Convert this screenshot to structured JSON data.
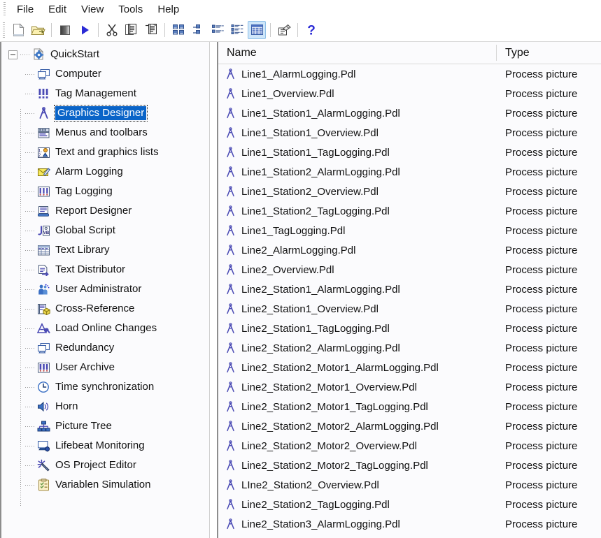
{
  "menubar": {
    "items": [
      {
        "label": "File",
        "name": "menu-file"
      },
      {
        "label": "Edit",
        "name": "menu-edit"
      },
      {
        "label": "View",
        "name": "menu-view"
      },
      {
        "label": "Tools",
        "name": "menu-tools"
      },
      {
        "label": "Help",
        "name": "menu-help"
      }
    ]
  },
  "toolbar": {
    "buttons": [
      {
        "icon": "new-document-icon",
        "active": false
      },
      {
        "icon": "open-folder-icon",
        "active": false
      },
      {
        "sep": true
      },
      {
        "icon": "stop-icon",
        "active": false
      },
      {
        "icon": "play-icon",
        "active": false
      },
      {
        "sep": true
      },
      {
        "icon": "cut-scissors-icon",
        "active": false
      },
      {
        "icon": "copy-icon",
        "active": false
      },
      {
        "icon": "paste-icon",
        "active": false
      },
      {
        "sep": true
      },
      {
        "icon": "large-icons-view-icon",
        "active": false
      },
      {
        "icon": "small-icons-view-icon",
        "active": false
      },
      {
        "icon": "list-view-icon",
        "active": false
      },
      {
        "icon": "tile-view-icon",
        "active": false
      },
      {
        "icon": "details-view-icon",
        "active": true
      },
      {
        "sep": true
      },
      {
        "icon": "properties-icon",
        "active": false
      },
      {
        "sep": true
      },
      {
        "icon": "help-question-icon",
        "active": false
      }
    ]
  },
  "colors": {
    "selection": "#0a64c8",
    "selection_text": "#ffffff",
    "toolbar_active": "#cfe6f9",
    "icon_blue": "#4a4ab4",
    "pane_background": "#fbfbfd"
  },
  "tree": {
    "root": {
      "label": "QuickStart",
      "icon": "project-gear-icon",
      "expanded": true
    },
    "items": [
      {
        "label": "Computer",
        "icon": "computer-icon",
        "selected": false
      },
      {
        "label": "Tag Management",
        "icon": "tag-management-icon",
        "selected": false
      },
      {
        "label": "Graphics Designer",
        "icon": "graphics-designer-icon",
        "selected": true
      },
      {
        "label": "Menus and toolbars",
        "icon": "menus-toolbars-icon",
        "selected": false
      },
      {
        "label": "Text and graphics lists",
        "icon": "text-graphics-lists-icon",
        "selected": false
      },
      {
        "label": "Alarm Logging",
        "icon": "alarm-logging-icon",
        "selected": false
      },
      {
        "label": "Tag Logging",
        "icon": "tag-logging-icon",
        "selected": false
      },
      {
        "label": "Report Designer",
        "icon": "report-designer-icon",
        "selected": false
      },
      {
        "label": "Global Script",
        "icon": "global-script-icon",
        "selected": false
      },
      {
        "label": "Text Library",
        "icon": "text-library-icon",
        "selected": false
      },
      {
        "label": "Text Distributor",
        "icon": "text-distributor-icon",
        "selected": false
      },
      {
        "label": "User Administrator",
        "icon": "user-administrator-icon",
        "selected": false
      },
      {
        "label": "Cross-Reference",
        "icon": "cross-reference-icon",
        "selected": false
      },
      {
        "label": "Load Online Changes",
        "icon": "load-online-changes-icon",
        "selected": false
      },
      {
        "label": "Redundancy",
        "icon": "redundancy-icon",
        "selected": false
      },
      {
        "label": "User Archive",
        "icon": "user-archive-icon",
        "selected": false
      },
      {
        "label": "Time synchronization",
        "icon": "clock-icon",
        "selected": false
      },
      {
        "label": "Horn",
        "icon": "speaker-horn-icon",
        "selected": false
      },
      {
        "label": "Picture Tree",
        "icon": "picture-tree-icon",
        "selected": false
      },
      {
        "label": "Lifebeat Monitoring",
        "icon": "lifebeat-monitoring-icon",
        "selected": false
      },
      {
        "label": "OS Project Editor",
        "icon": "os-project-editor-icon",
        "selected": false
      },
      {
        "label": "Variablen Simulation",
        "icon": "variablen-simulation-icon",
        "selected": false
      }
    ]
  },
  "list": {
    "columns": [
      {
        "label": "Name",
        "name": "column-header-name"
      },
      {
        "label": "Type",
        "name": "column-header-type"
      }
    ],
    "rows": [
      {
        "name": "Line1_AlarmLogging.Pdl",
        "type": "Process picture"
      },
      {
        "name": "Line1_Overview.Pdl",
        "type": "Process picture"
      },
      {
        "name": "Line1_Station1_AlarmLogging.Pdl",
        "type": "Process picture"
      },
      {
        "name": "Line1_Station1_Overview.Pdl",
        "type": "Process picture"
      },
      {
        "name": "Line1_Station1_TagLogging.Pdl",
        "type": "Process picture"
      },
      {
        "name": "Line1_Station2_AlarmLogging.Pdl",
        "type": "Process picture"
      },
      {
        "name": "Line1_Station2_Overview.Pdl",
        "type": "Process picture"
      },
      {
        "name": "Line1_Station2_TagLogging.Pdl",
        "type": "Process picture"
      },
      {
        "name": "Line1_TagLogging.Pdl",
        "type": "Process picture"
      },
      {
        "name": "Line2_AlarmLogging.Pdl",
        "type": "Process picture"
      },
      {
        "name": "Line2_Overview.Pdl",
        "type": "Process picture"
      },
      {
        "name": "Line2_Station1_AlarmLogging.Pdl",
        "type": "Process picture"
      },
      {
        "name": "Line2_Station1_Overview.Pdl",
        "type": "Process picture"
      },
      {
        "name": "Line2_Station1_TagLogging.Pdl",
        "type": "Process picture"
      },
      {
        "name": "Line2_Station2_AlarmLogging.Pdl",
        "type": "Process picture"
      },
      {
        "name": "Line2_Station2_Motor1_AlarmLogging.Pdl",
        "type": "Process picture"
      },
      {
        "name": "Line2_Station2_Motor1_Overview.Pdl",
        "type": "Process picture"
      },
      {
        "name": "Line2_Station2_Motor1_TagLogging.Pdl",
        "type": "Process picture"
      },
      {
        "name": "Line2_Station2_Motor2_AlarmLogging.Pdl",
        "type": "Process picture"
      },
      {
        "name": "Line2_Station2_Motor2_Overview.Pdl",
        "type": "Process picture"
      },
      {
        "name": "Line2_Station2_Motor2_TagLogging.Pdl",
        "type": "Process picture"
      },
      {
        "name": "LIne2_Station2_Overview.Pdl",
        "type": "Process picture"
      },
      {
        "name": "Line2_Station2_TagLogging.Pdl",
        "type": "Process picture"
      },
      {
        "name": "Line2_Station3_AlarmLogging.Pdl",
        "type": "Process picture"
      }
    ]
  }
}
